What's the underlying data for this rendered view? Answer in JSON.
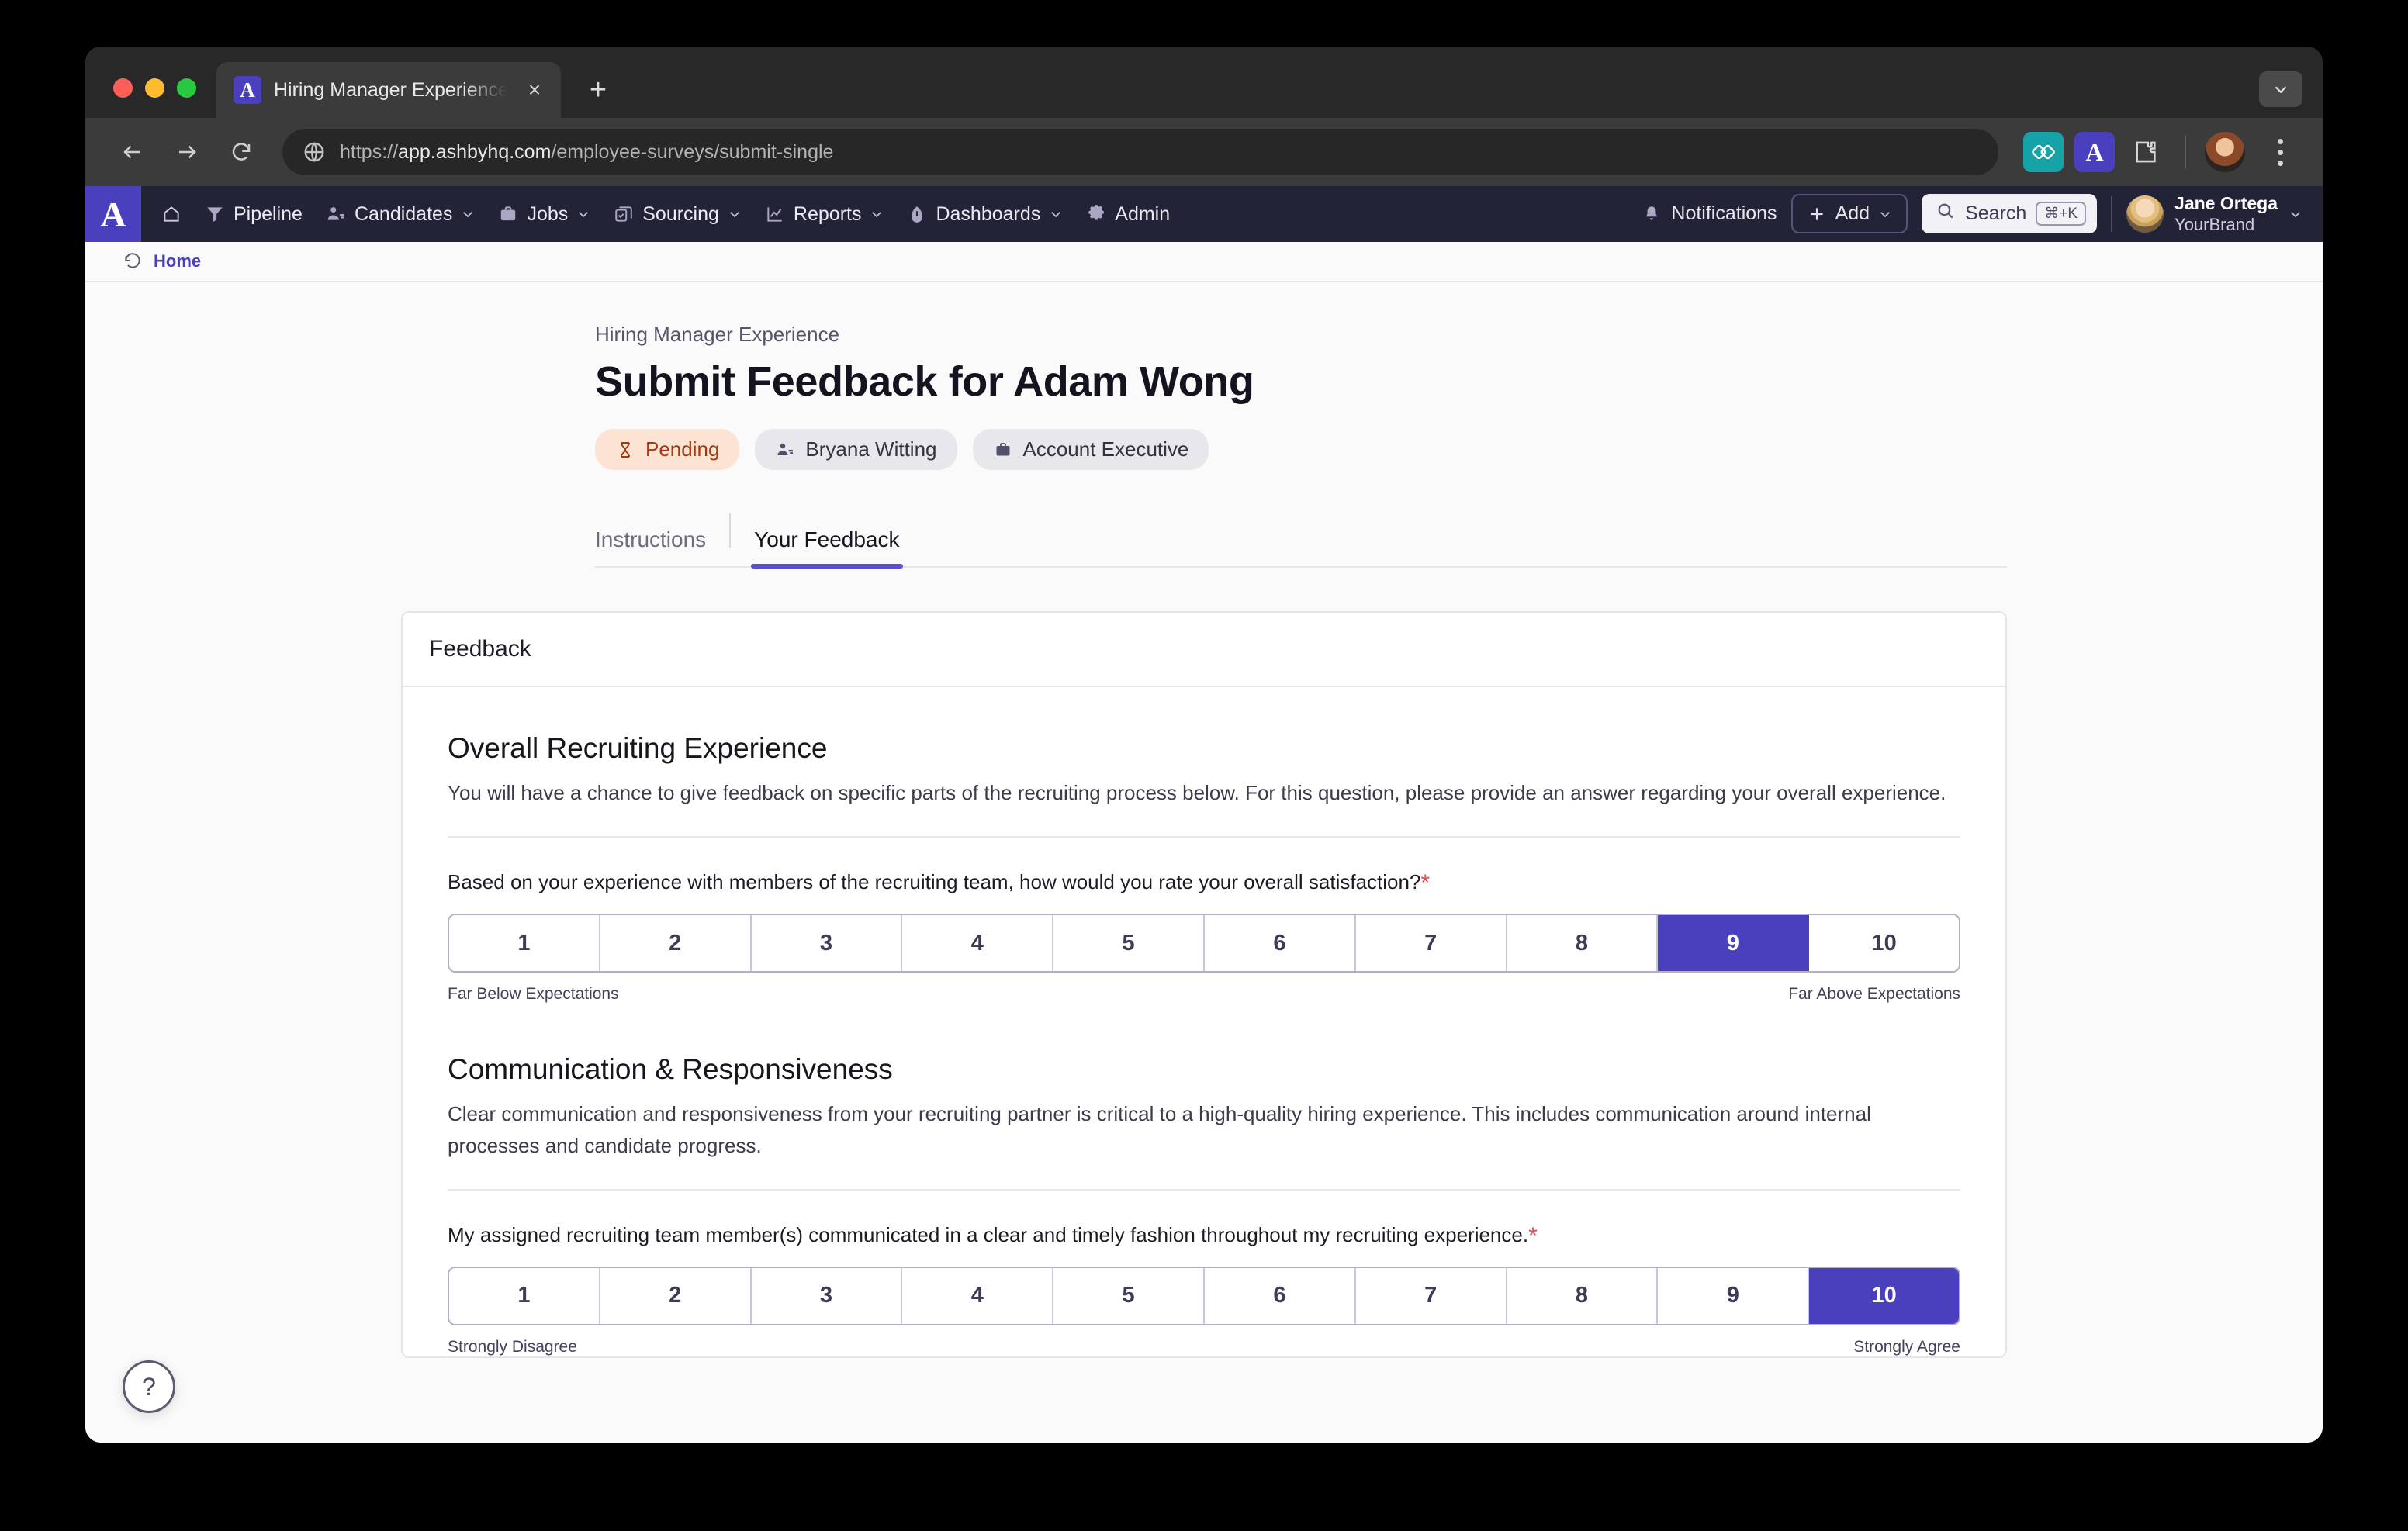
{
  "browser": {
    "tab_title": "Hiring Manager Experience ·",
    "url_scheme": "https://",
    "url_host": "app.ashbyhq.com",
    "url_path": "/employee-surveys/submit-single",
    "new_tab_label": "+",
    "close_label": "×",
    "favicon_letter": "A",
    "extension_ashby_letter": "A"
  },
  "appnav": {
    "brand_letter": "A",
    "items": [
      {
        "label": "Pipeline",
        "icon": "funnel-icon",
        "caret": false
      },
      {
        "label": "Candidates",
        "icon": "people-icon",
        "caret": true
      },
      {
        "label": "Jobs",
        "icon": "briefcase-icon",
        "caret": true
      },
      {
        "label": "Sourcing",
        "icon": "sourcing-icon",
        "caret": true
      },
      {
        "label": "Reports",
        "icon": "chart-icon",
        "caret": true
      },
      {
        "label": "Dashboards",
        "icon": "gauge-icon",
        "caret": true
      },
      {
        "label": "Admin",
        "icon": "gear-icon",
        "caret": false
      }
    ],
    "notifications_label": "Notifications",
    "add_label": "Add",
    "search_label": "Search",
    "search_shortcut": "⌘+K",
    "user_name": "Jane Ortega",
    "user_org": "YourBrand"
  },
  "breadcrumb": {
    "home_label": "Home"
  },
  "page": {
    "eyebrow": "Hiring Manager Experience",
    "title": "Submit Feedback for Adam Wong",
    "chips": [
      {
        "label": "Pending",
        "icon": "hourglass-icon",
        "style": "pending"
      },
      {
        "label": "Bryana Witting",
        "icon": "people-icon",
        "style": "plain"
      },
      {
        "label": "Account Executive",
        "icon": "briefcase-icon",
        "style": "plain"
      }
    ],
    "tabs": [
      {
        "label": "Instructions",
        "active": false
      },
      {
        "label": "Your Feedback",
        "active": true
      }
    ]
  },
  "card": {
    "header": "Feedback",
    "sections": [
      {
        "title": "Overall Recruiting Experience",
        "description": "You will have a chance to give feedback on specific parts of the recruiting process below. For this question, please provide an answer regarding your overall experience.",
        "question": "Based on your experience with members of the recruiting team, how would you rate your overall satisfaction?",
        "required": true,
        "required_mark": "*",
        "options": [
          "1",
          "2",
          "3",
          "4",
          "5",
          "6",
          "7",
          "8",
          "9",
          "10"
        ],
        "selected": "9",
        "left_label": "Far Below Expectations",
        "right_label": "Far Above Expectations"
      },
      {
        "title": "Communication & Responsiveness",
        "description": "Clear communication and responsiveness from your recruiting partner is critical to a high-quality hiring experience. This includes communication around internal processes and candidate progress.",
        "question": "My assigned recruiting team member(s) communicated in a clear and timely fashion throughout my recruiting experience.",
        "required": true,
        "required_mark": "*",
        "options": [
          "1",
          "2",
          "3",
          "4",
          "5",
          "6",
          "7",
          "8",
          "9",
          "10"
        ],
        "selected": "10",
        "left_label": "Strongly Disagree",
        "right_label": "Strongly Agree"
      }
    ]
  },
  "help": {
    "label": "?"
  },
  "colors": {
    "brand_purple": "#4a3fbd",
    "nav_background": "#232338",
    "pending_bg": "#fde3d4",
    "pending_fg": "#a33a12",
    "required_red": "#e04a53"
  }
}
